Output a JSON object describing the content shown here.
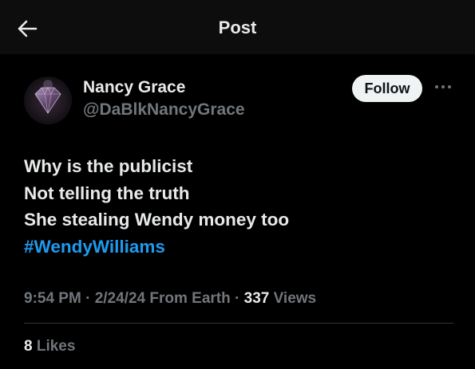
{
  "header": {
    "title": "Post",
    "back_icon": "arrow-left-icon"
  },
  "author": {
    "display_name": "Nancy Grace",
    "handle": "@DaBlkNancyGrace",
    "avatar_icon": "diamond-avatar"
  },
  "follow_button": {
    "label": "Follow"
  },
  "more_icon": "ellipsis-icon",
  "tweet": {
    "lines": [
      "Why is the publicist",
      "Not telling the truth",
      "She stealing Wendy money too"
    ],
    "hashtag": "#WendyWilliams"
  },
  "meta": {
    "time": "9:54 PM",
    "sep1": " · ",
    "date": "2/24/24",
    "location": " From Earth",
    "sep2": " · ",
    "views_count": "337",
    "views_label": " Views"
  },
  "stats": {
    "likes_count": "8",
    "likes_label": " Likes"
  },
  "colors": {
    "background": "#000000",
    "header_background": "#0d0d0d",
    "text_primary": "#e7e9ea",
    "text_secondary": "#71767b",
    "link": "#1d9bf0",
    "follow_button_bg": "#eff3f4",
    "divider": "#2f3336"
  }
}
